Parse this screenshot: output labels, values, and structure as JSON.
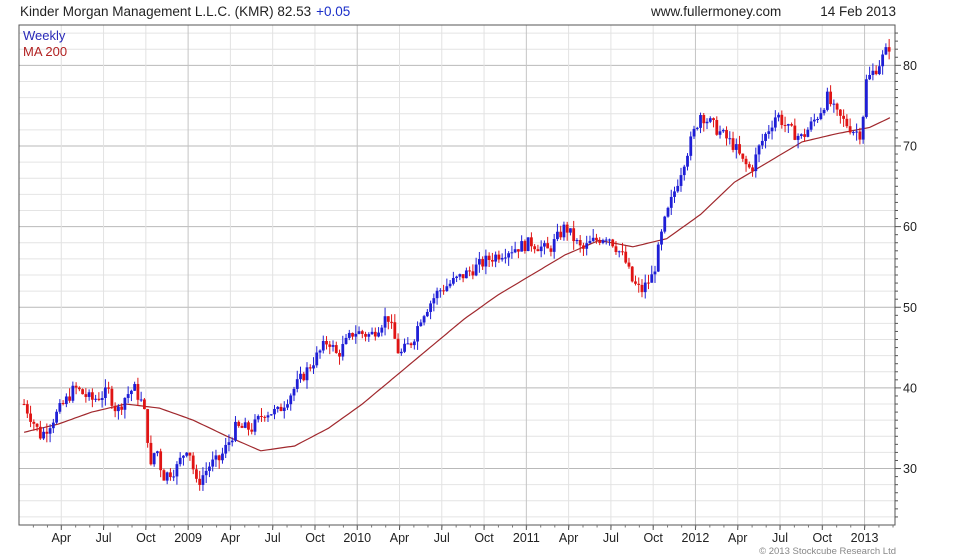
{
  "header": {
    "title": "Kinder Morgan Management L.L.C. (KMR) 82.53",
    "change": "+0.05",
    "site": "www.fullermoney.com",
    "date": "14 Feb 2013"
  },
  "legend": {
    "weekly": "Weekly",
    "ma": "MA 200"
  },
  "copyright": "© 2013 Stockcube Research Ltd",
  "colors": {
    "up": "#1f1fd6",
    "down": "#e01414",
    "ma": "#a0282d",
    "grid": "#cfcfcf",
    "frame": "#555555"
  },
  "chart_data": {
    "type": "line",
    "ylim": [
      23,
      85
    ],
    "y_ticks": [
      30,
      40,
      50,
      60,
      70,
      80
    ],
    "x_ticks": [
      {
        "label": "Apr",
        "t": 0.22
      },
      {
        "label": "Jul",
        "t": 0.47
      },
      {
        "label": "Oct",
        "t": 0.72
      },
      {
        "label": "2009",
        "t": 0.97
      },
      {
        "label": "Apr",
        "t": 1.22
      },
      {
        "label": "Jul",
        "t": 1.47
      },
      {
        "label": "Oct",
        "t": 1.72
      },
      {
        "label": "2010",
        "t": 1.97
      },
      {
        "label": "Apr",
        "t": 2.22
      },
      {
        "label": "Jul",
        "t": 2.47
      },
      {
        "label": "Oct",
        "t": 2.72
      },
      {
        "label": "2011",
        "t": 2.97
      },
      {
        "label": "Apr",
        "t": 3.22
      },
      {
        "label": "Jul",
        "t": 3.47
      },
      {
        "label": "Oct",
        "t": 3.72
      },
      {
        "label": "2012",
        "t": 3.97
      },
      {
        "label": "Apr",
        "t": 4.22
      },
      {
        "label": "Jul",
        "t": 4.47
      },
      {
        "label": "Oct",
        "t": 4.72
      },
      {
        "label": "2013",
        "t": 4.97
      }
    ],
    "series": [
      {
        "name": "Weekly",
        "kind": "candles",
        "t": [
          0.0,
          0.1,
          0.2,
          0.3,
          0.4,
          0.5,
          0.55,
          0.6,
          0.65,
          0.7,
          0.72,
          0.75,
          0.78,
          0.82,
          0.9,
          0.97,
          1.02,
          1.1,
          1.15,
          1.18,
          1.25,
          1.35,
          1.42,
          1.5,
          1.6,
          1.7,
          1.8,
          1.85,
          1.95,
          2.05,
          2.15,
          2.22,
          2.3,
          2.35,
          2.45,
          2.6,
          2.75,
          2.85,
          3.0,
          3.1,
          3.2,
          3.3,
          3.35,
          3.45,
          3.55,
          3.6,
          3.65,
          3.72,
          3.78,
          3.9,
          4.0,
          4.1,
          4.2,
          4.25,
          4.3,
          4.35,
          4.45,
          4.52,
          4.6,
          4.7,
          4.75,
          4.8,
          4.85,
          4.9,
          4.95,
          4.98,
          5.05,
          5.12
        ],
        "close": [
          38,
          34,
          37,
          40,
          38.5,
          39.5,
          37,
          39,
          40,
          38,
          36,
          30,
          33,
          29,
          30,
          33,
          28,
          30.5,
          31,
          32,
          35,
          35,
          37,
          37,
          40,
          43,
          46,
          44,
          47,
          46.5,
          49,
          44,
          46,
          49,
          52,
          54,
          56,
          57,
          58,
          57,
          60,
          57,
          58,
          59,
          56,
          53,
          52,
          54,
          60,
          68,
          74,
          72,
          70,
          68,
          67,
          70,
          74,
          72,
          71,
          74,
          76,
          74,
          73,
          72,
          71.5,
          78,
          80,
          82.5
        ]
      },
      {
        "name": "MA 200",
        "kind": "line",
        "t": [
          0.0,
          0.2,
          0.4,
          0.6,
          0.8,
          1.0,
          1.2,
          1.4,
          1.6,
          1.8,
          2.0,
          2.2,
          2.4,
          2.6,
          2.8,
          3.0,
          3.2,
          3.4,
          3.6,
          3.8,
          4.0,
          4.2,
          4.4,
          4.6,
          4.8,
          5.0,
          5.12
        ],
        "values": [
          34.5,
          35.5,
          37,
          38,
          37.5,
          36,
          34,
          32.2,
          32.8,
          35,
          38,
          41.5,
          45,
          48.5,
          51.5,
          54,
          56.5,
          58.3,
          57.5,
          58.5,
          61.5,
          65.5,
          68,
          70.5,
          71.5,
          72.3,
          73.5
        ]
      }
    ]
  }
}
